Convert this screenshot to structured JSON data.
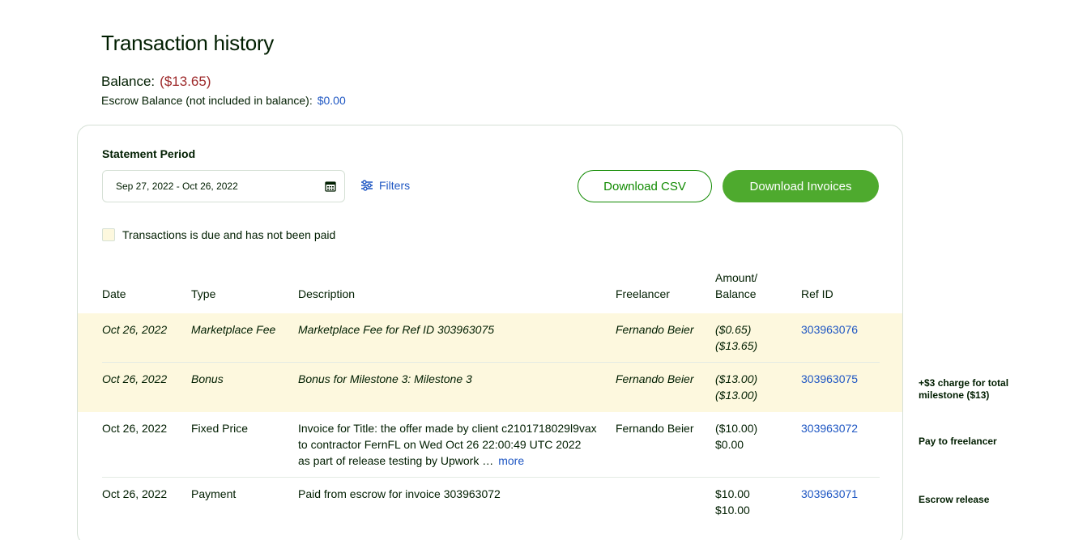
{
  "page": {
    "title": "Transaction history",
    "balance_label": "Balance:",
    "balance_value": "($13.65)",
    "escrow_label": "Escrow Balance (not included in balance):",
    "escrow_value": "$0.00"
  },
  "controls": {
    "period_label": "Statement Period",
    "date_range": "Sep 27, 2022 - Oct 26, 2022",
    "filters_label": "Filters",
    "download_csv": "Download CSV",
    "download_invoices": "Download Invoices",
    "legend_text": "Transactions is due and has not been paid"
  },
  "table": {
    "headers": {
      "date": "Date",
      "type": "Type",
      "description": "Description",
      "freelancer": "Freelancer",
      "amount_line1": "Amount/",
      "amount_line2": "Balance",
      "ref": "Ref ID"
    },
    "rows": [
      {
        "date": "Oct 26, 2022",
        "type": "Marketplace Fee",
        "description": "Marketplace Fee for Ref ID 303963075",
        "freelancer": "Fernando Beier",
        "amount": "($0.65)",
        "balance": "($13.65)",
        "ref": "303963076",
        "due": true
      },
      {
        "date": "Oct 26, 2022",
        "type": "Bonus",
        "description": "Bonus for Milestone 3: Milestone 3",
        "freelancer": "Fernando Beier",
        "amount": "($13.00)",
        "balance": "($13.00)",
        "ref": "303963075",
        "due": true
      },
      {
        "date": "Oct 26, 2022",
        "type": "Fixed Price",
        "description_line1": "Invoice for Title: the offer made by client c2101718029l9vax",
        "description_line2": "to contractor FernFL on Wed Oct 26 22:00:49 UTC 2022",
        "description_line3": "as part of release testing by Upwork …",
        "more": "more",
        "freelancer": "Fernando Beier",
        "amount": "($10.00)",
        "balance": "$0.00",
        "ref": "303963072",
        "due": false
      },
      {
        "date": "Oct 26, 2022",
        "type": "Payment",
        "description": "Paid from escrow for invoice 303963072",
        "freelancer": "",
        "amount": "$10.00",
        "balance": "$10.00",
        "ref": "303963071",
        "due": false
      }
    ]
  },
  "annotations": {
    "note1_line1": "+$3 charge for total",
    "note1_line2": "milestone ($13)",
    "note2": "Pay to freelancer",
    "note3": "Escrow release"
  },
  "icons": {
    "calendar": "calendar-icon",
    "filters": "sliders-icon"
  },
  "colors": {
    "accent_green": "#4eaa2e",
    "link_blue": "#1f57c3",
    "negative_red": "#9e2a2b",
    "due_highlight": "#fdf8de"
  }
}
